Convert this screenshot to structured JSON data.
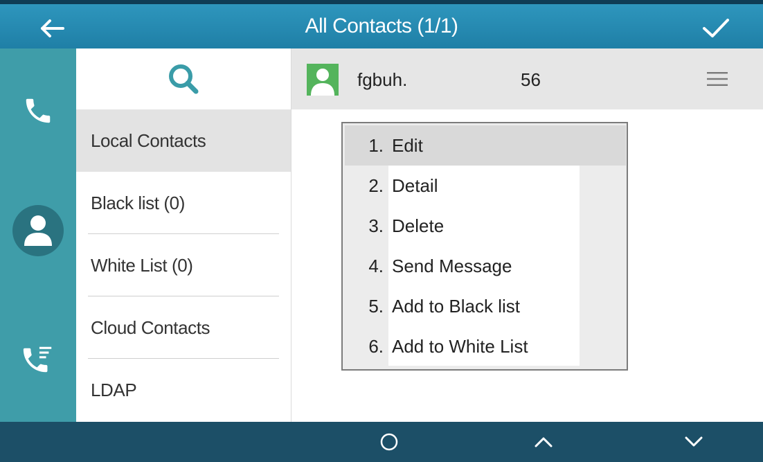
{
  "header": {
    "title": "All Contacts (1/1)",
    "back_icon": "arrow-left-icon",
    "confirm_icon": "checkmark-icon"
  },
  "rail": {
    "items": [
      {
        "icon": "phone-icon"
      },
      {
        "icon": "contacts-icon",
        "active": true
      },
      {
        "icon": "call-history-icon"
      }
    ]
  },
  "categories": {
    "search_icon": "search-icon",
    "items": [
      {
        "label": "Local Contacts",
        "selected": true
      },
      {
        "label": "Black list (0)"
      },
      {
        "label": "White List (0)"
      },
      {
        "label": "Cloud Contacts"
      },
      {
        "label": "LDAP"
      }
    ]
  },
  "contact": {
    "name": "fgbuh.",
    "number": "56"
  },
  "menu": {
    "items": [
      {
        "num": "1.",
        "label": "Edit",
        "highlighted": true
      },
      {
        "num": "2.",
        "label": "Detail"
      },
      {
        "num": "3.",
        "label": "Delete"
      },
      {
        "num": "4.",
        "label": "Send Message"
      },
      {
        "num": "5.",
        "label": "Add to Black list"
      },
      {
        "num": "6.",
        "label": "Add to White List"
      }
    ]
  },
  "softkeys": {
    "ok_icon": "circle-icon",
    "up_icon": "chevron-up-icon",
    "down_icon": "chevron-down-icon"
  },
  "colors": {
    "title_bar": "#2e96bd",
    "rail": "#3f9da9",
    "bottom_bar": "#1c4f67",
    "avatar_green": "#54b45c",
    "search_icon": "#3a9ca8"
  }
}
